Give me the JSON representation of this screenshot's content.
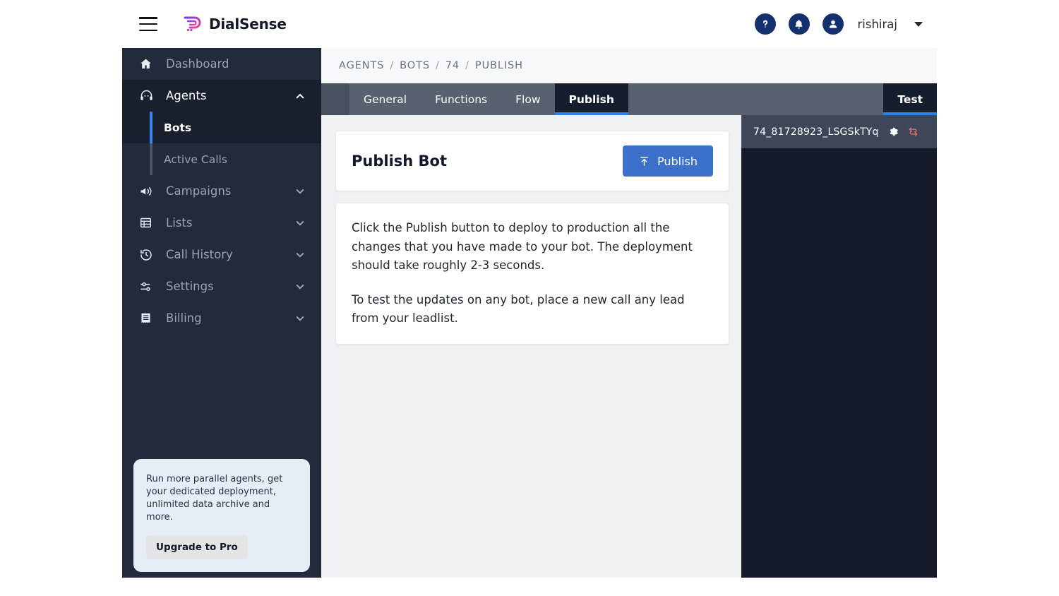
{
  "topbar": {
    "menu_icon": "hamburger-menu-icon",
    "brand": "DialSense",
    "help_icon": "help-circle-icon",
    "notifications_icon": "bell-icon",
    "account_icon": "user-circle-icon",
    "username": "rishiraj",
    "caret_icon": "chevron-down-icon"
  },
  "sidebar": {
    "items": [
      {
        "label": "Dashboard",
        "icon": "home-icon",
        "chevron": "",
        "open": false
      },
      {
        "label": "Agents",
        "icon": "headset-agent-icon",
        "chevron": "chevron-up-icon",
        "open": true
      },
      {
        "label": "Campaigns",
        "icon": "megaphone-icon",
        "chevron": "chevron-down-icon",
        "open": false
      },
      {
        "label": "Lists",
        "icon": "table-list-icon",
        "chevron": "chevron-down-icon",
        "open": false
      },
      {
        "label": "Call History",
        "icon": "history-clock-icon",
        "chevron": "chevron-down-icon",
        "open": false
      },
      {
        "label": "Settings",
        "icon": "sliders-icon",
        "chevron": "chevron-down-icon",
        "open": false
      },
      {
        "label": "Billing",
        "icon": "receipt-icon",
        "chevron": "chevron-down-icon",
        "open": false
      }
    ],
    "subitems": [
      {
        "label": "Bots",
        "active": true
      },
      {
        "label": "Active Calls",
        "active": false
      }
    ],
    "upgrade": {
      "text": "Run more parallel agents, get your dedicated deployment, unlimited data archive and more.",
      "button": "Upgrade to Pro"
    }
  },
  "breadcrumb": {
    "items": [
      "AGENTS",
      "BOTS",
      "74",
      "PUBLISH"
    ],
    "separator": "/"
  },
  "tabs": {
    "items": [
      {
        "label": "General",
        "active": false
      },
      {
        "label": "Functions",
        "active": false
      },
      {
        "label": "Flow",
        "active": false
      },
      {
        "label": "Publish",
        "active": true
      }
    ],
    "right": {
      "label": "Test",
      "active": true
    }
  },
  "main": {
    "card_title": "Publish Bot",
    "publish_button": "Publish",
    "publish_icon": "upload-icon",
    "paragraph_1": "Click the Publish button to deploy to production all the changes that you have made to your bot. The deployment should take roughly 2-3 seconds.",
    "paragraph_2": "To test the updates on any bot, place a new call any lead from your leadlist."
  },
  "right_panel": {
    "bot_id": "74_81728923_LSGSkTYq",
    "gear_icon": "gear-icon",
    "refresh_icon": "refresh-sync-icon"
  },
  "colors": {
    "accent_blue": "#3b71ca",
    "tab_active_underline": "#2f7eed",
    "sidebar_bg": "#222b3c",
    "panel_bg": "#151b2b",
    "refresh_red": "#e2706c"
  }
}
